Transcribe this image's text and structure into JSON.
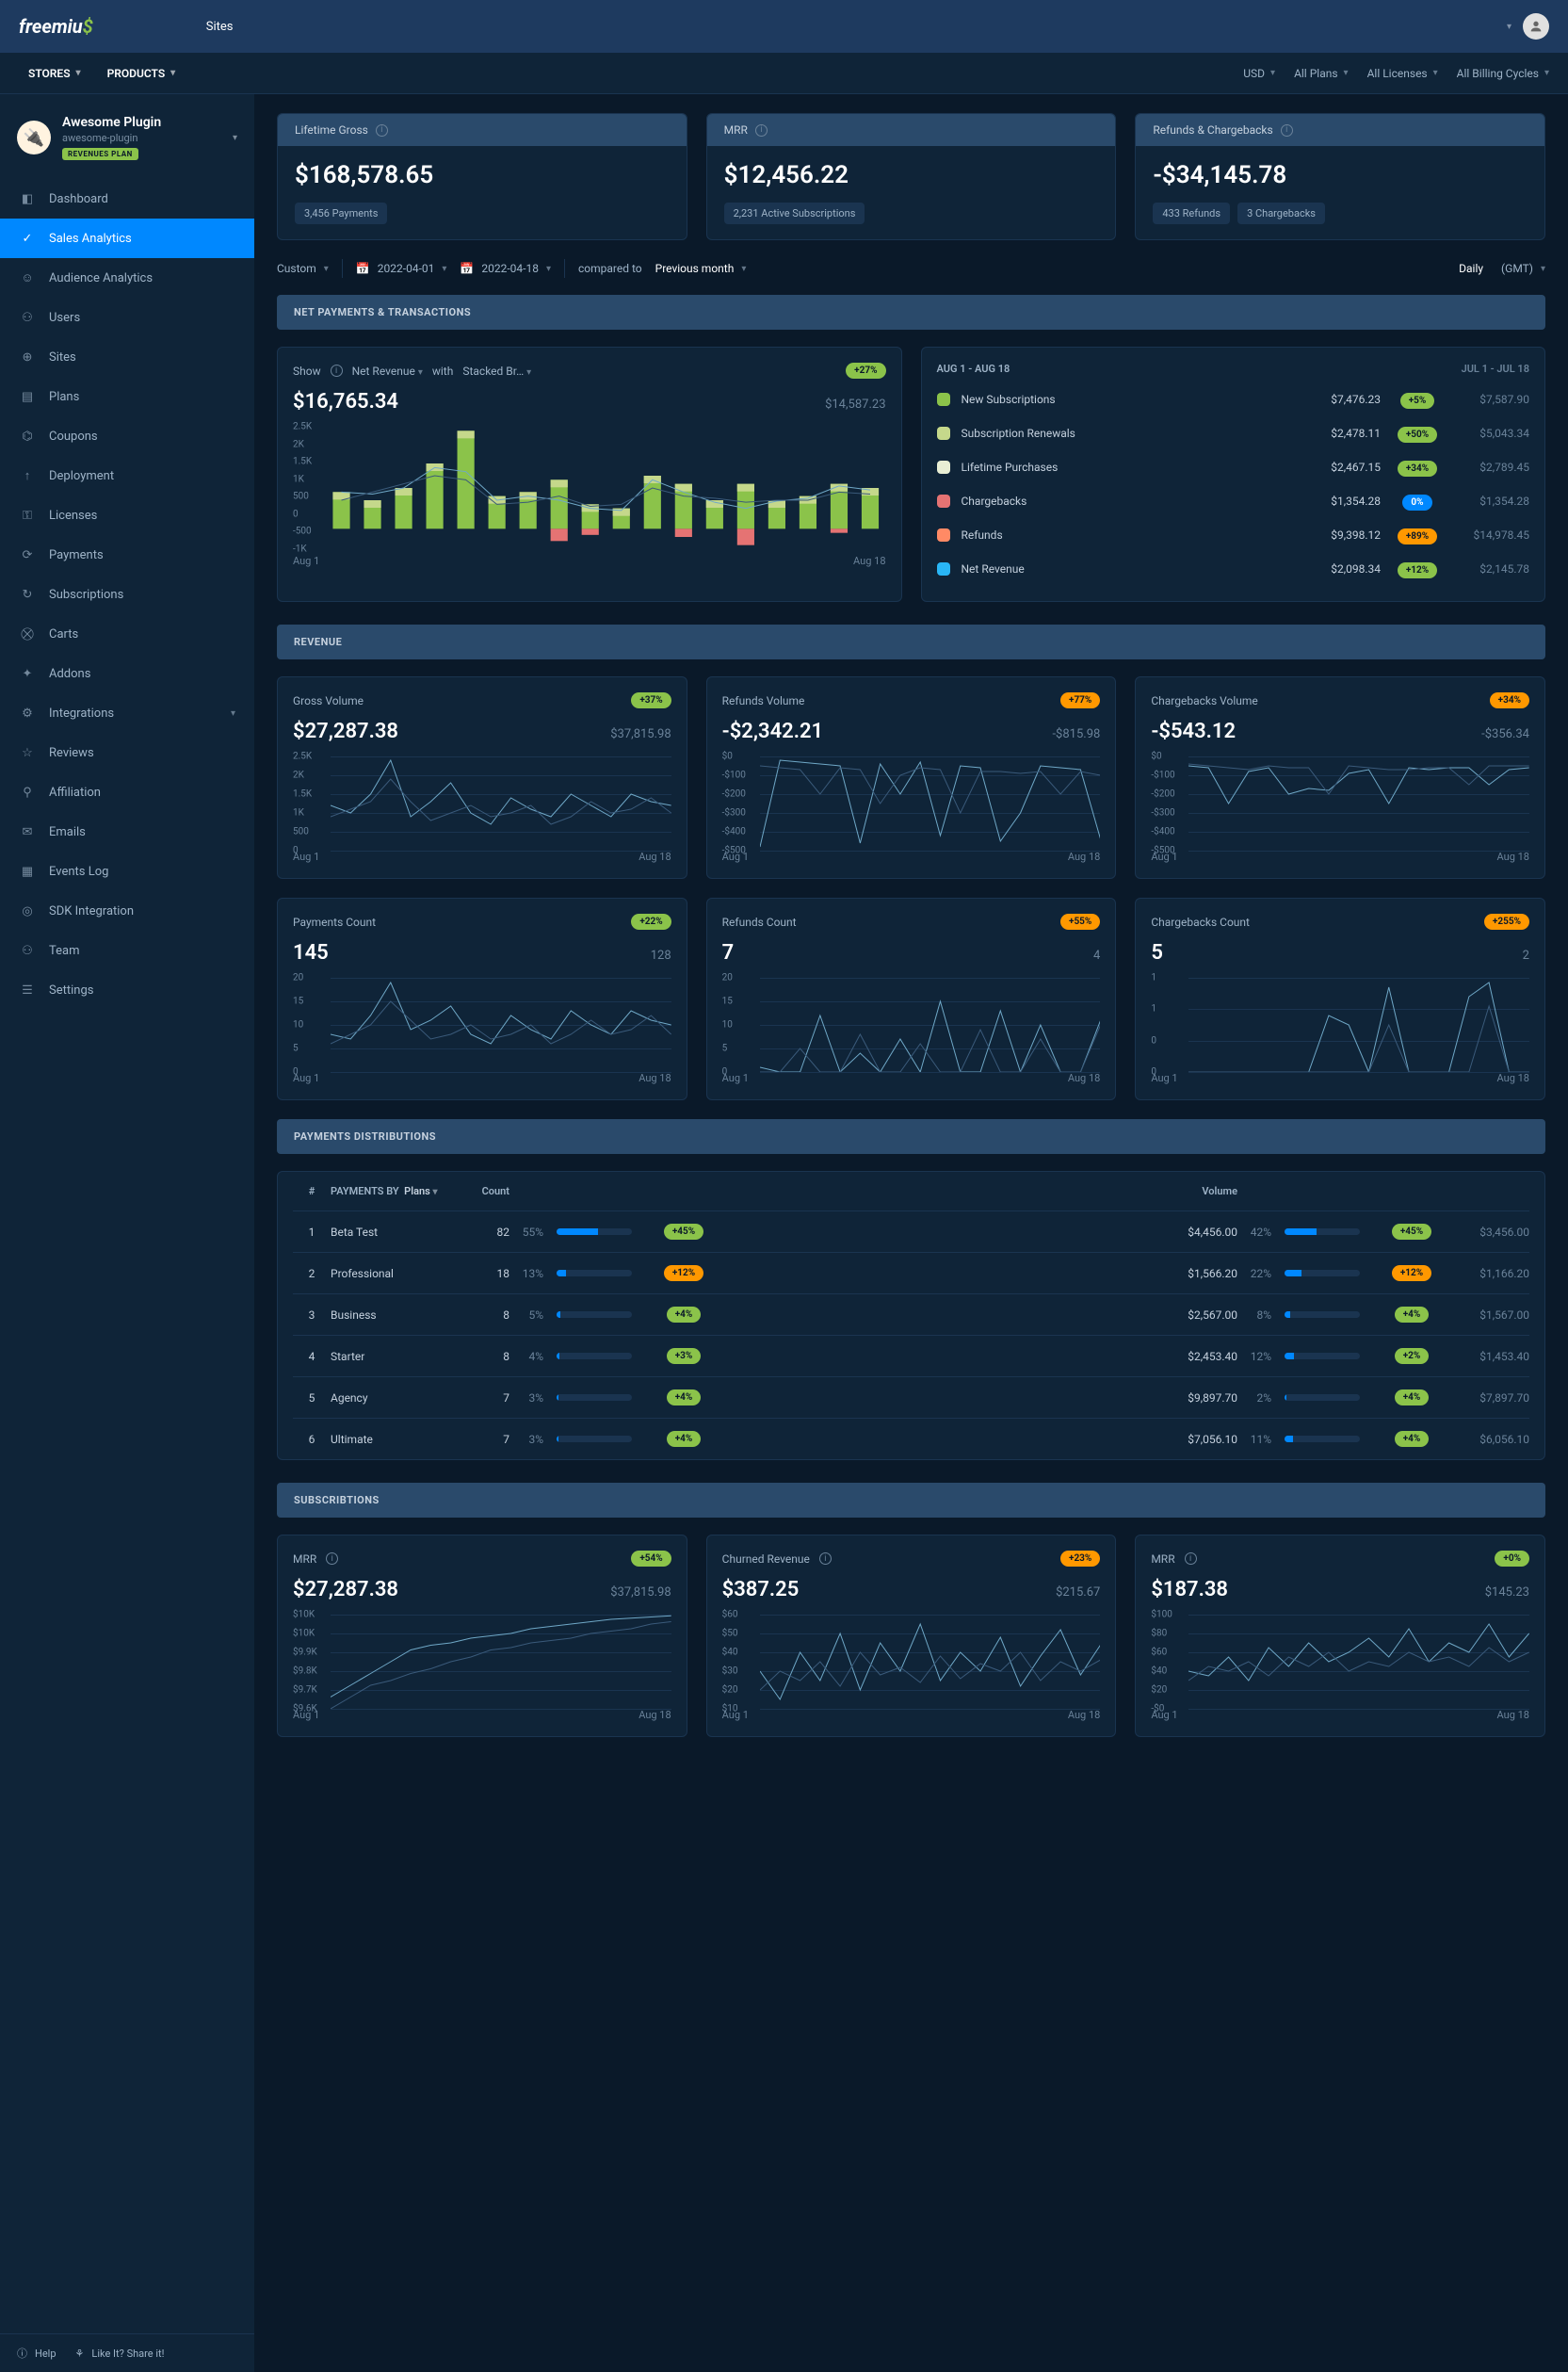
{
  "topbar": {
    "logo_text": "freemiu",
    "tab": "Sites"
  },
  "secbar": {
    "stores": "STORES",
    "products": "PRODUCTS",
    "currency": "USD",
    "plans": "All Plans",
    "licenses": "All Licenses",
    "cycles": "All Billing Cycles"
  },
  "product": {
    "title": "Awesome Plugin",
    "slug": "awesome-plugin",
    "badge": "REVENUES PLAN"
  },
  "nav": [
    {
      "label": "Dashboard",
      "icon": "◧"
    },
    {
      "label": "Sales Analytics",
      "icon": "✓",
      "active": true
    },
    {
      "label": "Audience Analytics",
      "icon": "☺"
    },
    {
      "label": "Users",
      "icon": "⚇"
    },
    {
      "label": "Sites",
      "icon": "⊕"
    },
    {
      "label": "Plans",
      "icon": "▤"
    },
    {
      "label": "Coupons",
      "icon": "⌬"
    },
    {
      "label": "Deployment",
      "icon": "↑"
    },
    {
      "label": "Licenses",
      "icon": "⚿"
    },
    {
      "label": "Payments",
      "icon": "⟳"
    },
    {
      "label": "Subscriptions",
      "icon": "↻"
    },
    {
      "label": "Carts",
      "icon": "⛒"
    },
    {
      "label": "Addons",
      "icon": "✦"
    },
    {
      "label": "Integrations",
      "icon": "⚙",
      "chevron": true
    },
    {
      "label": "Reviews",
      "icon": "☆"
    },
    {
      "label": "Affiliation",
      "icon": "⚲"
    },
    {
      "label": "Emails",
      "icon": "✉"
    },
    {
      "label": "Events Log",
      "icon": "▦"
    },
    {
      "label": "SDK Integration",
      "icon": "◎"
    },
    {
      "label": "Team",
      "icon": "⚇"
    },
    {
      "label": "Settings",
      "icon": "☰"
    }
  ],
  "footer": {
    "help": "Help",
    "share": "Like It? Share it!"
  },
  "kpi": [
    {
      "title": "Lifetime Gross",
      "value": "$168,578.65",
      "badges": [
        "3,456 Payments"
      ]
    },
    {
      "title": "MRR",
      "value": "$12,456.22",
      "badges": [
        "2,231 Active Subscriptions"
      ]
    },
    {
      "title": "Refunds & Chargebacks",
      "value": "-$34,145.78",
      "badges": [
        "433 Refunds",
        "3 Chargebacks"
      ]
    }
  ],
  "datebar": {
    "custom": "Custom",
    "from": "2022-04-01",
    "to": "2022-04-18",
    "compared": "compared to",
    "prev": "Previous month",
    "daily": "Daily",
    "tz": "(GMT)"
  },
  "sections": {
    "net": "NET PAYMENTS & TRANSACTIONS",
    "rev": "REVENUE",
    "dist": "PAYMENTS DISTRIBUTIONS",
    "subs": "SUBSCRIBTIONS"
  },
  "netChart": {
    "show": "Show",
    "metric": "Net Revenue",
    "with": "with",
    "style": "Stacked Br…",
    "pill": "+27%",
    "value": "$16,765.34",
    "compare": "$14,587.23",
    "x_start": "Aug 1",
    "x_end": "Aug 18"
  },
  "chart_data": {
    "net_bar": {
      "type": "bar",
      "title": "Net Revenue — Stacked Breakdown",
      "ylim": [
        -500,
        2500
      ],
      "y_ticks": [
        "2.5K",
        "2K",
        "1.5K",
        "1K",
        "500",
        "0",
        "-500",
        "-1K"
      ],
      "x_start": "Aug 1",
      "x_end": "Aug 18",
      "series": [
        {
          "name": "positive",
          "color": "#8bc34a",
          "values": [
            900,
            700,
            1000,
            1600,
            2400,
            800,
            900,
            1200,
            600,
            500,
            1300,
            1100,
            700,
            1100,
            700,
            800,
            1100,
            1000
          ]
        },
        {
          "name": "negative",
          "color": "#e57373",
          "values": [
            0,
            0,
            0,
            0,
            0,
            0,
            0,
            -300,
            -150,
            0,
            0,
            -200,
            0,
            -400,
            0,
            0,
            -100,
            0
          ]
        }
      ],
      "lines": [
        {
          "name": "current",
          "color": "#6fa8c7",
          "values": [
            900,
            850,
            1000,
            1500,
            1400,
            700,
            800,
            700,
            500,
            450,
            1200,
            900,
            650,
            500,
            680,
            750,
            1050,
            950
          ]
        },
        {
          "name": "previous",
          "color": "#3a5a7a",
          "values": [
            700,
            900,
            1100,
            1300,
            1200,
            600,
            650,
            800,
            550,
            600,
            1000,
            800,
            750,
            650,
            700,
            700,
            900,
            850
          ]
        }
      ]
    },
    "breakdown_table": {
      "type": "table",
      "period_current": "AUG 1 - AUG 18",
      "period_prev": "JUL 1 - JUL 18",
      "rows": [
        {
          "color": "#8bc34a",
          "label": "New Subscriptions",
          "value": "$7,476.23",
          "pill": "+5%",
          "pill_style": "green",
          "compare": "$7,587.90"
        },
        {
          "color": "#c5d88b",
          "label": "Subscription Renewals",
          "value": "$2,478.11",
          "pill": "+50%",
          "pill_style": "green",
          "compare": "$5,043.34"
        },
        {
          "color": "#e8eed4",
          "label": "Lifetime Purchases",
          "value": "$2,467.15",
          "pill": "+34%",
          "pill_style": "green",
          "compare": "$2,789.45"
        },
        {
          "color": "#e57373",
          "label": "Chargebacks",
          "value": "$1,354.28",
          "pill": "0%",
          "pill_style": "blue",
          "compare": "$1,354.28"
        },
        {
          "color": "#ff8a65",
          "label": "Refunds",
          "value": "$9,398.12",
          "pill": "+89%",
          "pill_style": "orange",
          "compare": "$14,978.45"
        },
        {
          "color": "#29b6f6",
          "label": "Net Revenue",
          "value": "$2,098.34",
          "pill": "+12%",
          "pill_style": "green",
          "compare": "$2,145.78"
        }
      ]
    },
    "revenue_cards": [
      {
        "title": "Gross Volume",
        "pill": "+37%",
        "pill_style": "green",
        "value": "$27,287.38",
        "compare": "$37,815.98",
        "y_ticks": [
          "2.5K",
          "2K",
          "1.5K",
          "1K",
          "500",
          "0"
        ],
        "ylim": [
          0,
          2500
        ],
        "series": [
          {
            "values": [
              1200,
              1000,
              1500,
              2400,
              900,
              1300,
              1800,
              1000,
              700,
              1400,
              1100,
              900,
              1500,
              1200,
              900,
              1500,
              1300,
              1200
            ]
          },
          {
            "values": [
              900,
              1100,
              1300,
              1900,
              1300,
              800,
              1000,
              1200,
              900,
              1000,
              1200,
              700,
              900,
              1300,
              1000,
              1100,
              1400,
              1000
            ]
          }
        ],
        "x_start": "Aug 1",
        "x_end": "Aug 18"
      },
      {
        "title": "Refunds Volume",
        "pill": "+77%",
        "pill_style": "orange",
        "value": "-$2,342.21",
        "compare": "-$815.98",
        "y_ticks": [
          "$0",
          "-$100",
          "-$200",
          "-$300",
          "-$400",
          "-$500"
        ],
        "ylim": [
          -500,
          0
        ],
        "series": [
          {
            "values": [
              -480,
              -20,
              -30,
              -40,
              -50,
              -460,
              -40,
              -200,
              -30,
              -420,
              -50,
              -60,
              -450,
              -300,
              -50,
              -60,
              -70,
              -440
            ]
          },
          {
            "values": [
              -50,
              -60,
              -70,
              -200,
              -60,
              -70,
              -250,
              -100,
              -60,
              -70,
              -300,
              -80,
              -80,
              -90,
              -80,
              -200,
              -80,
              -100
            ]
          }
        ],
        "x_start": "Aug 1",
        "x_end": "Aug 18"
      },
      {
        "title": "Chargebacks Volume",
        "pill": "+34%",
        "pill_style": "orange",
        "value": "-$543.12",
        "compare": "-$356.34",
        "y_ticks": [
          "$0",
          "-$100",
          "-$200",
          "-$300",
          "-$400",
          "-$500"
        ],
        "ylim": [
          -500,
          0
        ],
        "series": [
          {
            "values": [
              -50,
              -60,
              -250,
              -80,
              -60,
              -200,
              -170,
              -180,
              -90,
              -70,
              -250,
              -60,
              -70,
              -60,
              -60,
              -150,
              -70,
              -60
            ]
          },
          {
            "values": [
              -40,
              -50,
              -60,
              -70,
              -50,
              -60,
              -60,
              -200,
              -50,
              -60,
              -70,
              -70,
              -60,
              -60,
              -150,
              -50,
              -50,
              -50
            ]
          }
        ],
        "x_start": "Aug 1",
        "x_end": "Aug 18"
      },
      {
        "title": "Payments Count",
        "pill": "+22%",
        "pill_style": "green",
        "value": "145",
        "compare": "128",
        "y_ticks": [
          "20",
          "15",
          "10",
          "5",
          "0"
        ],
        "ylim": [
          0,
          20
        ],
        "series": [
          {
            "values": [
              8,
              7,
              12,
              19,
              9,
              11,
              14,
              8,
              6,
              12,
              9,
              7,
              13,
              10,
              8,
              13,
              11,
              10
            ]
          },
          {
            "values": [
              6,
              8,
              10,
              15,
              11,
              7,
              8,
              10,
              7,
              8,
              10,
              6,
              8,
              11,
              8,
              9,
              12,
              8
            ]
          }
        ],
        "x_start": "Aug 1",
        "x_end": "Aug 18"
      },
      {
        "title": "Refunds Count",
        "pill": "+55%",
        "pill_style": "orange",
        "value": "7",
        "compare": "4",
        "y_ticks": [
          "20",
          "15",
          "10",
          "5",
          "0"
        ],
        "ylim": [
          0,
          20
        ],
        "series": [
          {
            "values": [
              1,
              0,
              0,
              12,
              0,
              4,
              0,
              7,
              0,
              15,
              0,
              0,
              13,
              0,
              10,
              0,
              0,
              11
            ]
          },
          {
            "values": [
              0,
              0,
              5,
              0,
              0,
              8,
              0,
              0,
              6,
              0,
              0,
              9,
              0,
              0,
              7,
              0,
              0,
              10
            ]
          }
        ],
        "x_start": "Aug 1",
        "x_end": "Aug 18"
      },
      {
        "title": "Chargebacks Count",
        "pill": "+255%",
        "pill_style": "orange",
        "value": "5",
        "compare": "2",
        "y_ticks": [
          "1",
          "1",
          "0",
          "0"
        ],
        "ylim": [
          0,
          1
        ],
        "series": [
          {
            "values": [
              0,
              0,
              0,
              0,
              0,
              0,
              0,
              0.6,
              0.5,
              0,
              0.9,
              0,
              0,
              0,
              0.8,
              0.95,
              0,
              0
            ]
          },
          {
            "values": [
              0,
              0,
              0,
              0,
              0,
              0,
              0,
              0,
              0,
              0,
              0.5,
              0,
              0,
              0,
              0,
              0.7,
              0,
              0
            ]
          }
        ],
        "x_start": "Aug 1",
        "x_end": "Aug 18"
      }
    ],
    "distribution": {
      "type": "table",
      "headers": {
        "idx": "#",
        "by": "PAYMENTS BY",
        "group": "Plans",
        "count": "Count",
        "volume": "Volume"
      },
      "rows": [
        {
          "idx": 1,
          "name": "Beta Test",
          "count": 82,
          "count_pct": "55%",
          "count_bar": 55,
          "count_pill": "+45%",
          "count_pill_style": "green",
          "volume": "$4,456.00",
          "vol_pct": "42%",
          "vol_bar": 42,
          "vol_pill": "+45%",
          "vol_pill_style": "green",
          "vol_val": "$3,456.00"
        },
        {
          "idx": 2,
          "name": "Professional",
          "count": 18,
          "count_pct": "13%",
          "count_bar": 13,
          "count_pill": "+12%",
          "count_pill_style": "orange",
          "volume": "$1,566.20",
          "vol_pct": "22%",
          "vol_bar": 22,
          "vol_pill": "+12%",
          "vol_pill_style": "orange",
          "vol_val": "$1,166.20"
        },
        {
          "idx": 3,
          "name": "Business",
          "count": 8,
          "count_pct": "5%",
          "count_bar": 5,
          "count_pill": "+4%",
          "count_pill_style": "green",
          "volume": "$2,567.00",
          "vol_pct": "8%",
          "vol_bar": 8,
          "vol_pill": "+4%",
          "vol_pill_style": "green",
          "vol_val": "$1,567.00"
        },
        {
          "idx": 4,
          "name": "Starter",
          "count": 8,
          "count_pct": "4%",
          "count_bar": 4,
          "count_pill": "+3%",
          "count_pill_style": "green",
          "volume": "$2,453.40",
          "vol_pct": "12%",
          "vol_bar": 12,
          "vol_pill": "+2%",
          "vol_pill_style": "green",
          "vol_val": "$1,453.40"
        },
        {
          "idx": 5,
          "name": "Agency",
          "count": 7,
          "count_pct": "3%",
          "count_bar": 3,
          "count_pill": "+4%",
          "count_pill_style": "green",
          "volume": "$9,897.70",
          "vol_pct": "2%",
          "vol_bar": 2,
          "vol_pill": "+4%",
          "vol_pill_style": "green",
          "vol_val": "$7,897.70"
        },
        {
          "idx": 6,
          "name": "Ultimate",
          "count": 7,
          "count_pct": "3%",
          "count_bar": 3,
          "count_pill": "+4%",
          "count_pill_style": "green",
          "volume": "$7,056.10",
          "vol_pct": "11%",
          "vol_bar": 11,
          "vol_pill": "+4%",
          "vol_pill_style": "green",
          "vol_val": "$6,056.10"
        }
      ]
    },
    "subs_cards": [
      {
        "title": "MRR",
        "pill": "+54%",
        "pill_style": "green",
        "value": "$27,287.38",
        "compare": "$37,815.98",
        "y_ticks": [
          "$10K",
          "$10K",
          "$9.9K",
          "$9.8K",
          "$9.7K",
          "$9.6K"
        ],
        "ylim": [
          9600,
          10000
        ],
        "series": [
          {
            "values": [
              9650,
              9700,
              9750,
              9800,
              9850,
              9870,
              9880,
              9900,
              9910,
              9920,
              9940,
              9950,
              9960,
              9970,
              9980,
              9985,
              9990,
              9995
            ]
          },
          {
            "values": [
              9600,
              9650,
              9700,
              9720,
              9750,
              9770,
              9800,
              9820,
              9850,
              9860,
              9880,
              9890,
              9900,
              9920,
              9930,
              9940,
              9960,
              9970
            ]
          }
        ],
        "x_start": "Aug 1",
        "x_end": "Aug 18"
      },
      {
        "title": "Churned Revenue",
        "pill": "+23%",
        "pill_style": "orange",
        "value": "$387.25",
        "compare": "$215.67",
        "y_ticks": [
          "$60",
          "$50",
          "$40",
          "$30",
          "$20",
          "$10"
        ],
        "ylim": [
          10,
          60
        ],
        "series": [
          {
            "values": [
              30,
              15,
              40,
              25,
              50,
              20,
              45,
              30,
              55,
              25,
              40,
              30,
              48,
              22,
              38,
              52,
              28,
              44
            ]
          },
          {
            "values": [
              20,
              30,
              25,
              35,
              22,
              40,
              28,
              32,
              24,
              38,
              26,
              34,
              30,
              40,
              25,
              35,
              30,
              36
            ]
          }
        ],
        "x_start": "Aug 1",
        "x_end": "Aug 18"
      },
      {
        "title": "MRR",
        "pill": "+0%",
        "pill_style": "green",
        "value": "$187.38",
        "compare": "$145.23",
        "y_ticks": [
          "$100",
          "$80",
          "$60",
          "$40",
          "$20",
          "-$0"
        ],
        "ylim": [
          0,
          100
        ],
        "series": [
          {
            "values": [
              40,
              35,
              55,
              30,
              65,
              45,
              70,
              50,
              60,
              75,
              55,
              85,
              50,
              70,
              60,
              90,
              55,
              80
            ]
          },
          {
            "values": [
              30,
              45,
              40,
              50,
              35,
              55,
              45,
              60,
              40,
              50,
              45,
              60,
              50,
              55,
              45,
              65,
              50,
              60
            ]
          }
        ],
        "x_start": "Aug 1",
        "x_end": "Aug 18"
      }
    ]
  }
}
